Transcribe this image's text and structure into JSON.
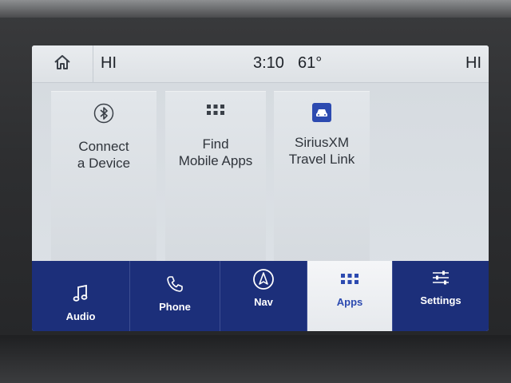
{
  "status": {
    "left_temp": "HI",
    "time": "3:10",
    "outside_temp": "61°",
    "right_temp": "HI",
    "home_icon": "home-icon"
  },
  "tiles": [
    {
      "label_line1": "Connect",
      "label_line2": "a Device",
      "icon": "bluetooth-icon"
    },
    {
      "label_line1": "Find",
      "label_line2": "Mobile Apps",
      "icon": "grid-icon"
    },
    {
      "label_line1": "SiriusXM",
      "label_line2": "Travel Link",
      "icon": "car-icon"
    }
  ],
  "nav": {
    "items": [
      {
        "label": "Audio",
        "icon": "music-note-icon",
        "active": false
      },
      {
        "label": "Phone",
        "icon": "phone-icon",
        "active": false
      },
      {
        "label": "Nav",
        "icon": "navigation-icon",
        "active": false
      },
      {
        "label": "Apps",
        "icon": "grid-icon",
        "active": true
      },
      {
        "label": "Settings",
        "icon": "sliders-icon",
        "active": false
      }
    ]
  },
  "colors": {
    "nav_bg": "#1c2f7a",
    "accent": "#2c4ab0",
    "screen_bg": "#d9dee3"
  }
}
